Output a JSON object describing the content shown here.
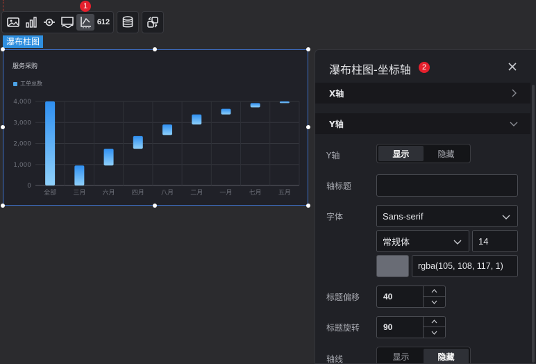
{
  "toolbar": {
    "buttons": [
      "image-icon",
      "bar-chart-icon",
      "eye-target-icon",
      "screen-wave-icon",
      "axis-icon",
      "number-icon",
      "database-icon",
      "link-swap-icon"
    ],
    "number_label": "612",
    "badge_1": "1"
  },
  "component": {
    "tag": "瀑布柱图",
    "chart_title": "服务采购",
    "legend_label": "工单总数"
  },
  "chart_data": {
    "type": "bar",
    "title": "服务采购",
    "categories": [
      "全部",
      "三月",
      "六月",
      "四月",
      "八月",
      "二月",
      "一月",
      "七月",
      "五月"
    ],
    "series": [
      {
        "name": "工单总数",
        "base": [
          0,
          0,
          950,
          1750,
          2400,
          2900,
          3380,
          3720,
          3920
        ],
        "top": [
          4000,
          950,
          1750,
          2350,
          2900,
          3380,
          3650,
          3920,
          4000
        ]
      }
    ],
    "ylim": [
      0,
      4000
    ],
    "yticks": [
      "0",
      "1,000",
      "2,000",
      "3,000",
      "4,000"
    ],
    "colors": {
      "bar_top": "#2f8ff0",
      "bar_bottom": "#8fd0fa"
    }
  },
  "panel": {
    "title": "瀑布柱图-坐标轴",
    "badge_2": "2",
    "sections": {
      "x_axis": "X轴",
      "y_axis": "Y轴"
    },
    "y_axis_label": "Y轴",
    "show": "显示",
    "hide": "隐藏",
    "axis_title_label": "轴标题",
    "axis_title_value": "",
    "font_label": "字体",
    "font_family": "Sans-serif",
    "font_style": "常规体",
    "font_size": "14",
    "font_color": "rgba(105, 108, 117, 1)",
    "title_offset_label": "标题偏移",
    "title_offset": "40",
    "title_rotate_label": "标题旋转",
    "title_rotate": "90",
    "axis_line_label": "轴线",
    "axis_line_show": "显示",
    "axis_line_hide": "隐藏"
  }
}
